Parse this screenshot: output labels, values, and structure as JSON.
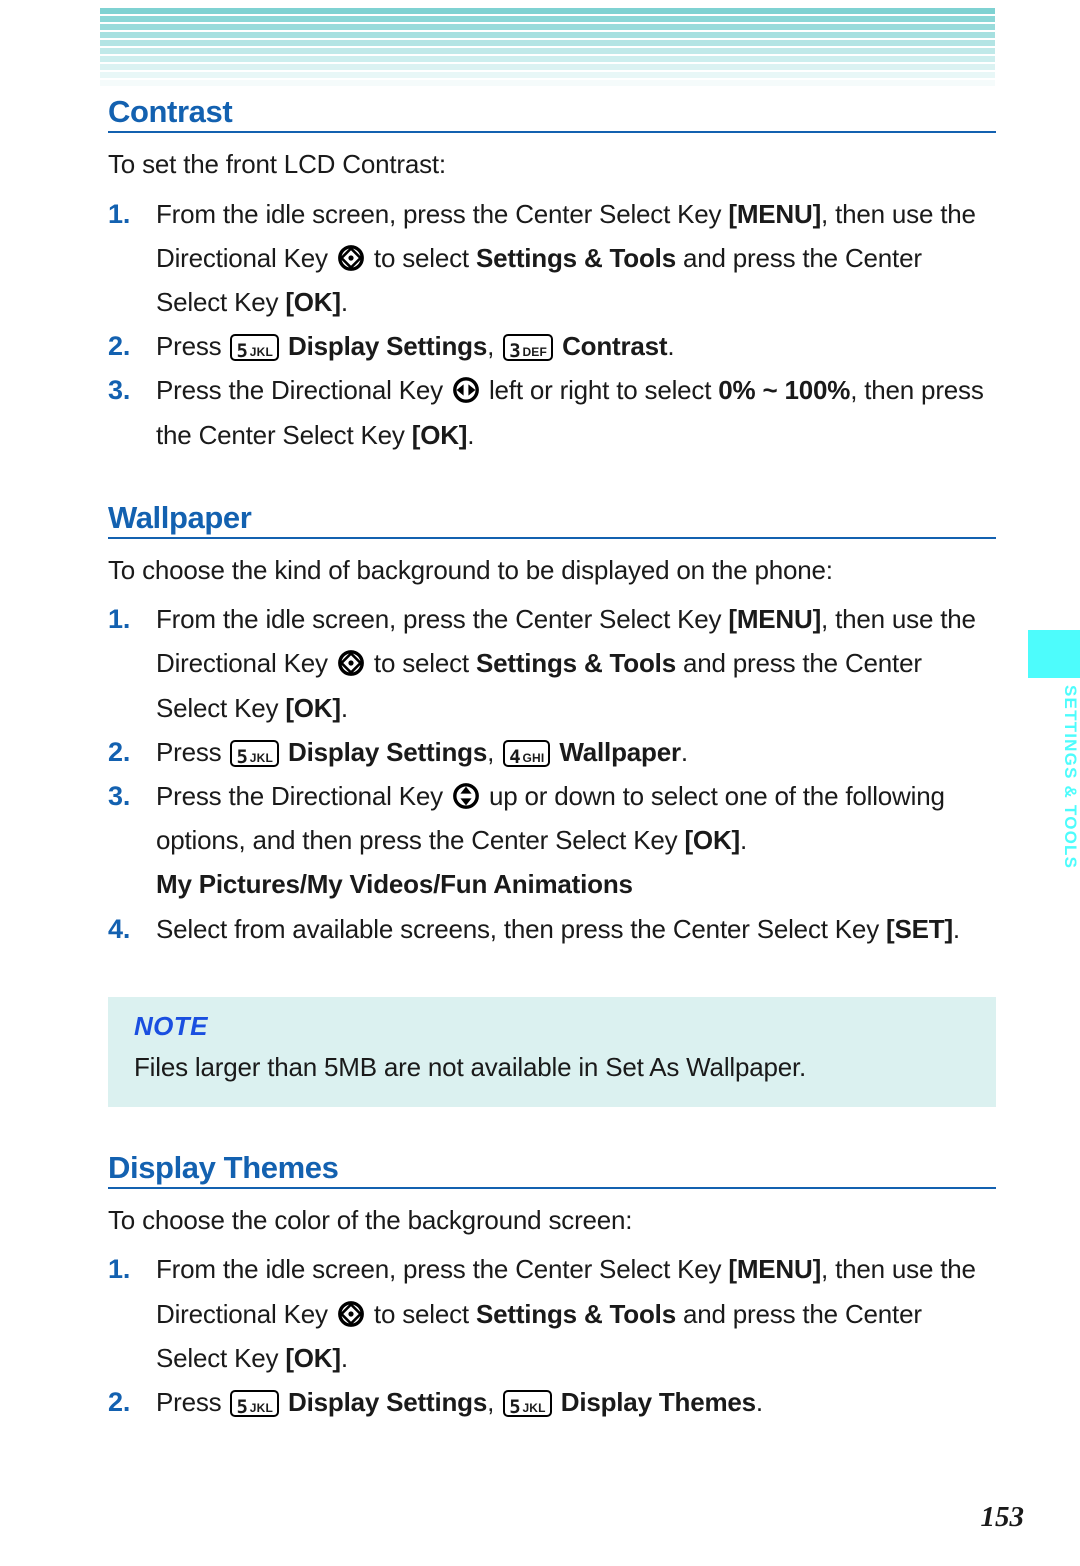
{
  "header": {
    "stripe_color": "#7fd2d2",
    "stripe_count": 10
  },
  "colors": {
    "heading_blue": "#1361b0",
    "step_number_blue": "#1361b0",
    "note_bg": "#dbf1f0",
    "note_title_blue": "#1a4fe0",
    "tab_cyan": "#4dfcfc"
  },
  "side_tab": {
    "label": "SETTINGS & TOOLS"
  },
  "page_number": "153",
  "sections": [
    {
      "heading": "Contrast",
      "intro": "To set the front LCD Contrast:",
      "steps": [
        {
          "number": "1.",
          "parts": [
            {
              "t": "text",
              "v": "From the idle screen, press the Center Select Key "
            },
            {
              "t": "bold",
              "v": "[MENU]"
            },
            {
              "t": "text",
              "v": ", then use the Directional Key "
            },
            {
              "t": "icon",
              "v": "dirkey-all-icon"
            },
            {
              "t": "text",
              "v": " to select "
            },
            {
              "t": "bold",
              "v": "Settings & Tools"
            },
            {
              "t": "text",
              "v": " and press the Center Select Key "
            },
            {
              "t": "bold",
              "v": "[OK]"
            },
            {
              "t": "text",
              "v": "."
            }
          ]
        },
        {
          "number": "2.",
          "parts": [
            {
              "t": "text",
              "v": "Press "
            },
            {
              "t": "keycap",
              "digit": "5",
              "letters": "JKL"
            },
            {
              "t": "bold",
              "v": " Display Settings"
            },
            {
              "t": "text",
              "v": ", "
            },
            {
              "t": "keycap",
              "digit": "3",
              "letters": "DEF"
            },
            {
              "t": "bold",
              "v": " Contrast"
            },
            {
              "t": "text",
              "v": "."
            }
          ]
        },
        {
          "number": "3.",
          "parts": [
            {
              "t": "text",
              "v": "Press the Directional Key "
            },
            {
              "t": "icon",
              "v": "dirkey-leftright-icon"
            },
            {
              "t": "text",
              "v": " left or right to select "
            },
            {
              "t": "bold",
              "v": "0% ~ 100%"
            },
            {
              "t": "text",
              "v": ", then press the Center Select Key "
            },
            {
              "t": "bold",
              "v": "[OK]"
            },
            {
              "t": "text",
              "v": "."
            }
          ]
        }
      ]
    },
    {
      "heading": "Wallpaper",
      "intro": "To choose the kind of background to be displayed on the phone:",
      "steps": [
        {
          "number": "1.",
          "parts": [
            {
              "t": "text",
              "v": "From the idle screen, press the Center Select Key "
            },
            {
              "t": "bold",
              "v": "[MENU]"
            },
            {
              "t": "text",
              "v": ", then use the Directional Key "
            },
            {
              "t": "icon",
              "v": "dirkey-all-icon"
            },
            {
              "t": "text",
              "v": " to select "
            },
            {
              "t": "bold",
              "v": "Settings & Tools"
            },
            {
              "t": "text",
              "v": " and press the Center Select Key "
            },
            {
              "t": "bold",
              "v": "[OK]"
            },
            {
              "t": "text",
              "v": "."
            }
          ]
        },
        {
          "number": "2.",
          "parts": [
            {
              "t": "text",
              "v": "Press "
            },
            {
              "t": "keycap",
              "digit": "5",
              "letters": "JKL"
            },
            {
              "t": "bold",
              "v": " Display Settings"
            },
            {
              "t": "text",
              "v": ", "
            },
            {
              "t": "keycap",
              "digit": "4",
              "letters": "GHI"
            },
            {
              "t": "bold",
              "v": " Wallpaper"
            },
            {
              "t": "text",
              "v": "."
            }
          ]
        },
        {
          "number": "3.",
          "parts": [
            {
              "t": "text",
              "v": "Press the Directional Key "
            },
            {
              "t": "icon",
              "v": "dirkey-updown-icon"
            },
            {
              "t": "text",
              "v": " up or down to select one of the following options, and then press the Center Select Key "
            },
            {
              "t": "bold",
              "v": "[OK]"
            },
            {
              "t": "text",
              "v": "."
            }
          ],
          "sub_bold": "My Pictures/My Videos/Fun Animations"
        },
        {
          "number": "4.",
          "parts": [
            {
              "t": "text",
              "v": "Select from available screens, then press the Center Select Key "
            },
            {
              "t": "bold",
              "v": "[SET]"
            },
            {
              "t": "text",
              "v": "."
            }
          ]
        }
      ],
      "note": {
        "title": "NOTE",
        "text": "Files larger than 5MB are not available in Set As Wallpaper."
      }
    },
    {
      "heading": "Display Themes",
      "intro": "To choose the color of the background screen:",
      "steps": [
        {
          "number": "1.",
          "parts": [
            {
              "t": "text",
              "v": "From the idle screen, press the Center Select Key "
            },
            {
              "t": "bold",
              "v": "[MENU]"
            },
            {
              "t": "text",
              "v": ", then use the Directional Key "
            },
            {
              "t": "icon",
              "v": "dirkey-all-icon"
            },
            {
              "t": "text",
              "v": " to select "
            },
            {
              "t": "bold",
              "v": "Settings & Tools"
            },
            {
              "t": "text",
              "v": " and press the Center Select Key "
            },
            {
              "t": "bold",
              "v": "[OK]"
            },
            {
              "t": "text",
              "v": "."
            }
          ]
        },
        {
          "number": "2.",
          "parts": [
            {
              "t": "text",
              "v": "Press "
            },
            {
              "t": "keycap",
              "digit": "5",
              "letters": "JKL"
            },
            {
              "t": "bold",
              "v": " Display Settings"
            },
            {
              "t": "text",
              "v": ", "
            },
            {
              "t": "keycap",
              "digit": "5",
              "letters": "JKL"
            },
            {
              "t": "bold",
              "v": " Display Themes"
            },
            {
              "t": "text",
              "v": "."
            }
          ]
        }
      ]
    }
  ]
}
